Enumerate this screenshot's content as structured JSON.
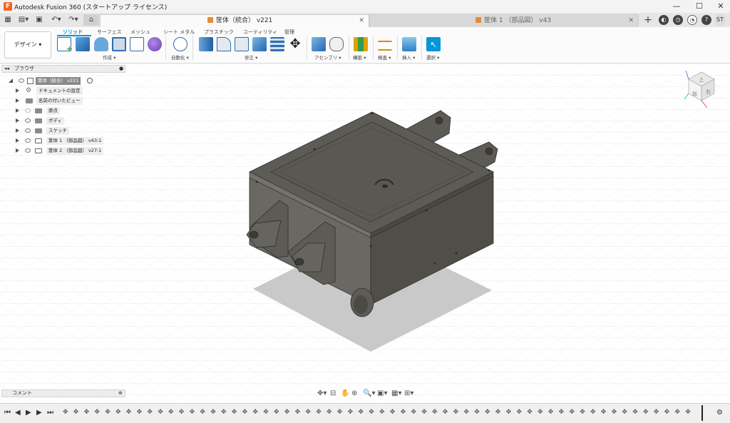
{
  "window": {
    "title": "Autodesk Fusion 360 (スタートアップ ライセンス)",
    "controls": [
      "—",
      "☐",
      "✕"
    ]
  },
  "tabs": [
    {
      "label": "筐体（統合） v221",
      "active": true
    },
    {
      "label": "筐体 1 （部品図） v43",
      "active": false
    }
  ],
  "header_right": {
    "user_initials": "ST"
  },
  "ribbon": {
    "workspace_label": "デザイン ▾",
    "tabs": [
      "ソリッド",
      "サーフェス",
      "メッシュ",
      "シート メタル",
      "プラスチック",
      "ユーティリティ",
      "管理"
    ],
    "groups": [
      "作成 ▾",
      "自動化 ▾",
      "修正 ▾",
      "アセンブリ ▾",
      "構築 ▾",
      "検査 ▾",
      "挿入 ▾",
      "選択 ▾"
    ]
  },
  "browser": {
    "title": "ブラウザ",
    "root_label": "筐体（統合） v221",
    "items": [
      {
        "label": "ドキュメントの設定"
      },
      {
        "label": "名前の付いたビュー"
      },
      {
        "label": "原点"
      },
      {
        "label": "ボディ"
      },
      {
        "label": "スケッチ"
      },
      {
        "label": "筐体 1 （部品図） v43:1"
      },
      {
        "label": "筐体 2 （部品図） v27:1"
      }
    ]
  },
  "viewcube": {
    "face_top": "上",
    "face_front": "前",
    "face_right": "右"
  },
  "comments": {
    "label": "コメント"
  },
  "colors": {
    "accent": "#0696d7",
    "model": "#5b5953",
    "shadow": "#c7c7c7"
  }
}
